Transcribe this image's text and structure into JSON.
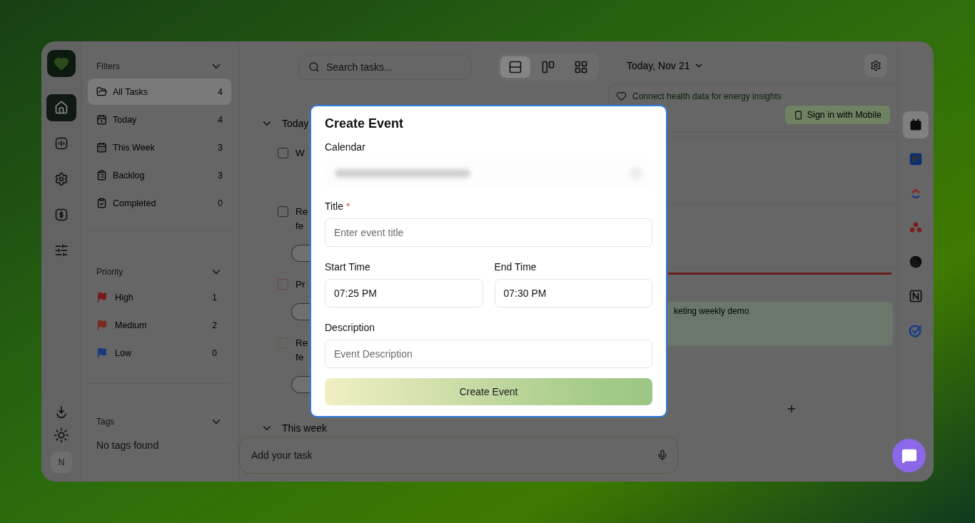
{
  "nav_items": [
    {
      "selected": true
    },
    {
      "selected": false
    },
    {
      "selected": false
    },
    {
      "selected": false
    },
    {
      "selected": false
    }
  ],
  "user_initial": "N",
  "filters": {
    "title": "Filters",
    "items": [
      {
        "label": "All Tasks",
        "count": "4",
        "selected": true
      },
      {
        "label": "Today",
        "count": "4",
        "selected": false
      },
      {
        "label": "This Week",
        "count": "3",
        "selected": false
      },
      {
        "label": "Backlog",
        "count": "3",
        "selected": false
      },
      {
        "label": "Completed",
        "count": "0",
        "selected": false
      }
    ]
  },
  "priority": {
    "title": "Priority",
    "items": [
      {
        "label": "High",
        "count": "1",
        "color": "#7a1c1c"
      },
      {
        "label": "Medium",
        "count": "2",
        "color": "#7a2c22"
      },
      {
        "label": "Low",
        "count": "0",
        "color": "#1c3a80"
      }
    ]
  },
  "tags": {
    "title": "Tags",
    "empty_text": "No tags found"
  },
  "search": {
    "placeholder": "Search tasks..."
  },
  "view_modes": [
    {
      "selected": true
    },
    {
      "selected": false
    },
    {
      "selected": false
    }
  ],
  "task_groups": [
    {
      "title": "Today",
      "tasks": [
        {
          "lines": [
            "W"
          ],
          "color": "#2a2a2a",
          "chip": false
        },
        {
          "lines": [
            "Re",
            "fe"
          ],
          "color": "#2a2a2a",
          "chip": true
        },
        {
          "lines": [
            "Pr"
          ],
          "color": "#6e2020",
          "chip": true
        },
        {
          "lines": [
            "Re",
            "fe"
          ],
          "color": "#5a4e2a",
          "chip": true
        }
      ]
    },
    {
      "title": "This week"
    }
  ],
  "add_task": {
    "placeholder": "Add your task"
  },
  "date_picker": "Today, Nov 21",
  "health_banner": {
    "text": "Connect health data for energy insights",
    "button": "Sign in with Mobile"
  },
  "calendar_events": [
    {
      "title": "keting weekly demo"
    }
  ],
  "integrations": [
    {
      "selected": true
    },
    {
      "selected": false
    },
    {
      "selected": false
    },
    {
      "selected": false
    },
    {
      "selected": false
    },
    {
      "selected": false
    },
    {
      "selected": false
    }
  ],
  "modal": {
    "title": "Create Event",
    "calendar_label": "Calendar",
    "title_label": "Title",
    "required_mark": "*",
    "title_placeholder": "Enter event title",
    "start_label": "Start Time",
    "start_value": "07:25 PM",
    "end_label": "End Time",
    "end_value": "07:30 PM",
    "description_label": "Description",
    "description_placeholder": "Event Description",
    "submit": "Create Event"
  }
}
